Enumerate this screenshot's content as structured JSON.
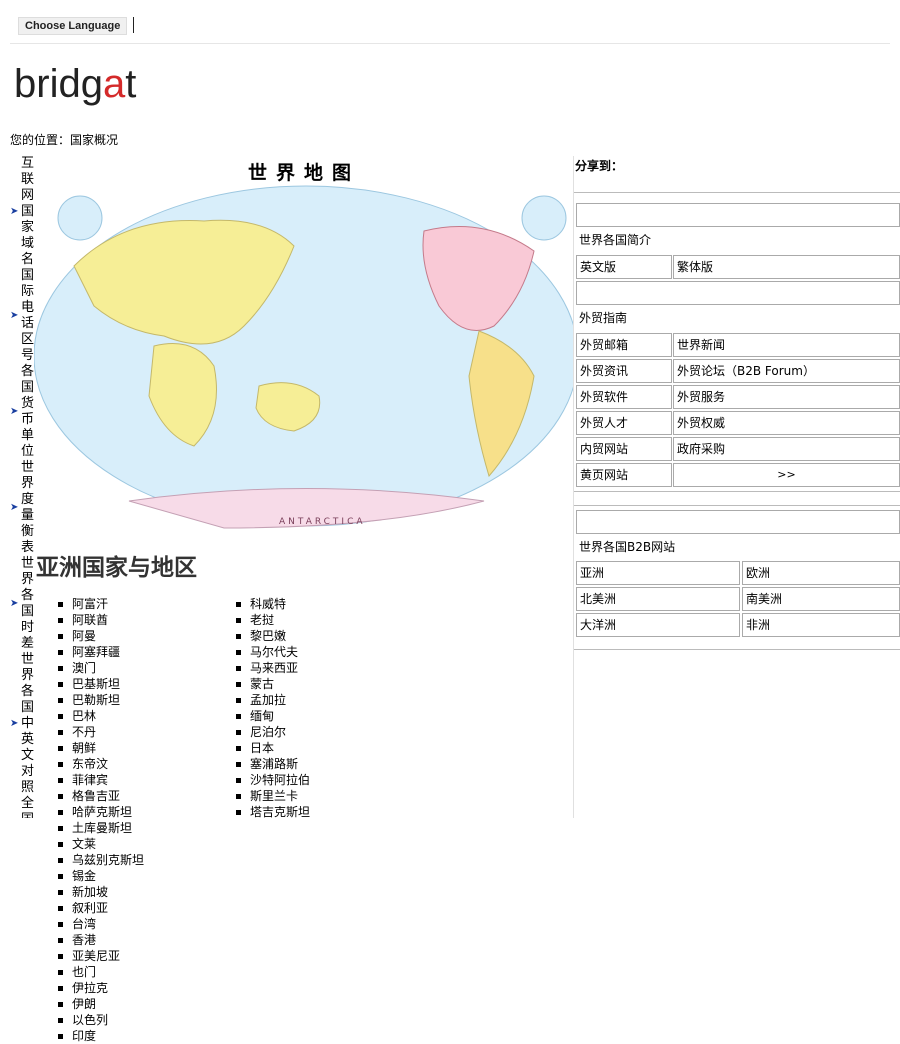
{
  "header": {
    "language_button": "Choose Language",
    "logo_prefix": "bridg",
    "logo_accent": "a",
    "logo_suffix": "t"
  },
  "breadcrumb": "您的位置：国家概况",
  "left_nav": [
    "互联网国家域名",
    "国际电话区号",
    "各国货币单位",
    "世界度量衡表",
    "世界各国时差",
    "世界各国中英文对照",
    "全国电话区号",
    "全"
  ],
  "map": {
    "title": "世界地图",
    "label_antarctica": "ANTARCTICA"
  },
  "region_title": "亚洲国家与地区",
  "countries": [
    [
      "阿富汗",
      "阿联酋",
      "阿曼",
      "阿塞拜疆",
      "澳门",
      "巴基斯坦",
      "巴勒斯坦",
      "巴林",
      "不丹",
      "朝鲜",
      "东帝汶",
      "菲律宾",
      "格鲁吉亚",
      "哈萨克斯坦"
    ],
    [
      "科威特",
      "老挝",
      "黎巴嫩",
      "马尔代夫",
      "马来西亚",
      "蒙古",
      "孟加拉",
      "缅甸",
      "尼泊尔",
      "日本",
      "塞浦路斯",
      "沙特阿拉伯",
      "斯里兰卡",
      "塔吉克斯坦"
    ],
    [
      "土库曼斯坦",
      "文莱",
      "乌兹别克斯坦",
      "锡金",
      "新加坡",
      "叙利亚",
      "台湾",
      "香港",
      "亚美尼亚",
      "也门",
      "伊拉克",
      "伊朗",
      "以色列",
      "印度"
    ]
  ],
  "sidebar": {
    "share_label": "分享到：",
    "intro_header": "世界各国简介",
    "intro_links": [
      "英文版",
      "繁体版"
    ],
    "trade_header": "外贸指南",
    "trade_links": [
      [
        "外贸邮箱",
        "世界新闻"
      ],
      [
        "外贸资讯",
        "外贸论坛（B2B Forum）"
      ],
      [
        "外贸软件",
        "外贸服务"
      ],
      [
        "外贸人才",
        "外贸权威"
      ],
      [
        "内贸网站",
        "政府采购"
      ],
      [
        "黄页网站",
        ">>"
      ]
    ],
    "b2b_header": "世界各国B2B网站",
    "b2b_links": [
      [
        "亚洲",
        "欧洲"
      ],
      [
        "北美洲",
        "南美洲"
      ],
      [
        "大洋洲",
        "非洲"
      ]
    ]
  },
  "colors": {
    "ocean": "#d8eefa",
    "land": "#f6ee96",
    "antarctica": "#f7dbe8",
    "nav_arrow": "#1a3fa0",
    "logo_accent": "#d42a2a"
  }
}
